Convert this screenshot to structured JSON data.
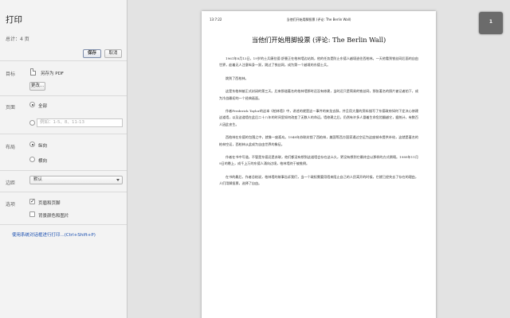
{
  "sidebar": {
    "title": "打印",
    "total": "总计：4 页",
    "print_label": "保存",
    "cancel_label": "取消",
    "destination": {
      "label": "目标",
      "value": "另存为 PDF",
      "change_label": "更改..."
    },
    "pages": {
      "label": "页面",
      "all_label": "全部",
      "range_placeholder": "例如：1-5、8、11-13"
    },
    "layout": {
      "label": "布局",
      "portrait_label": "纵向",
      "landscape_label": "横向"
    },
    "margins": {
      "label": "边距",
      "value": "默认"
    },
    "options": {
      "label": "选项",
      "headers_footers_label": "页眉和页脚",
      "background_graphics_label": "背景颜色和图片"
    },
    "system_dialog_link": "使用系统对话框进行打印...(Ctrl+Shift+P)"
  },
  "preview": {
    "header_time": "13:7:22",
    "header_title": "当他们开始用脚投票 (评论: The Berlin Wall)",
    "doc_title": "当他们开始用脚投票 (评论: The Berlin Wall)",
    "page_number": "1",
    "paragraphs": [
      "1961年8月13日，19岁的士兵康拉德·舒曼正在柏林墙边站岗，他的任务是防止东德人越境逃往西柏林。一天他看到铁丝网后面的自由世界，趁着无人注意纵身一跃，跳过了铁丝网，成为第一个越境的东德士兵。",
      "跳到了西柏林。",
      "这是东柏林被正式封闭的第三天。后来那道著名的柏林墙那时还没有修建，当时还只是简易的铁丝网，那张著名的照片被记者拍下，成为冷战最初的一个经典画面。",
      "作者Frederick Taylor的这本《柏林墙》中，讲述的就是这一事件的来龙去脉，并且用大量的资料描写了东德政府如何下定决心修建这道墙，以及这道墙在此后二十八年的时间里如何改变了无数人的命运。墙修建之后，仍然有许多人冒着生命危险翻越它，据统计，有数百人因此丧生。",
      "西柏林在东德的包围之中，就像一座孤岛。1948年苏联封锁了西柏林，美国等西方国家通过空运为这座城市提供补给，这就是著名的柏林空运，西柏林从此成为自由世界的象征。",
      "作者在书中写道，不管是东德还是苏联，他们都没有想到这道墙会存在这么久，更没有想到它最终会以那样的方式倒塌。1989年11月9日的晚上，成千上万的东德人涌向边境，柏林墙终于被推倒。",
      "在书的最后，作者总结说，柏林墙的故事告诉我们，当一个政权需要用墙来阻止自己的人民离开的时候，它就已经失去了存在的理由，人们用脚投票，选择了自由。"
    ]
  }
}
